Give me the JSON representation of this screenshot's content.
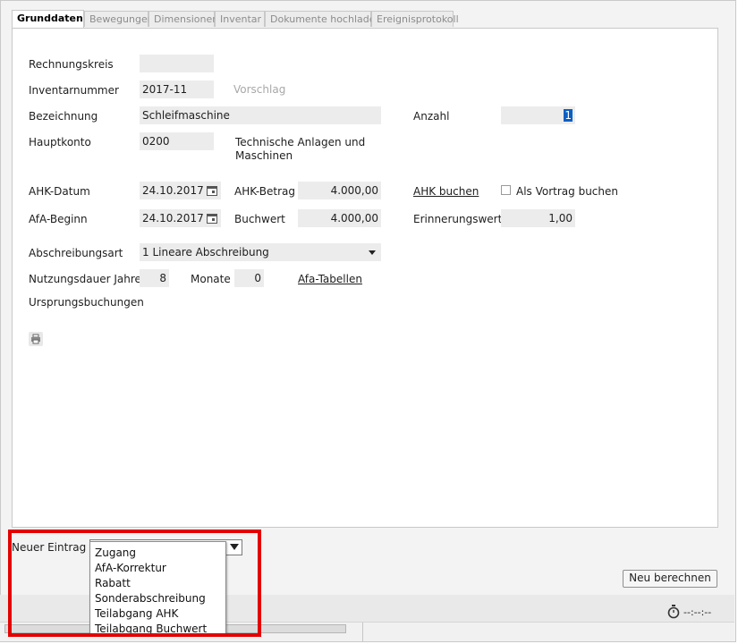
{
  "tabs": [
    {
      "label": "Grunddaten",
      "active": true
    },
    {
      "label": "Bewegungen",
      "active": false
    },
    {
      "label": "Dimensionen",
      "active": false
    },
    {
      "label": "Inventar",
      "active": false
    },
    {
      "label": "Dokumente hochladen",
      "active": false
    },
    {
      "label": "Ereignisprotokoll",
      "active": false
    }
  ],
  "form": {
    "rechnungskreis_label": "Rechnungskreis",
    "rechnungskreis_value": "",
    "inventarnummer_label": "Inventarnummer",
    "inventarnummer_value": "2017-11",
    "vorschlag_label": "Vorschlag",
    "bezeichnung_label": "Bezeichnung",
    "bezeichnung_value": "Schleifmaschine",
    "anzahl_label": "Anzahl",
    "anzahl_value": "1",
    "hauptkonto_label": "Hauptkonto",
    "hauptkonto_value": "0200",
    "hauptkonto_desc_line1": "Technische Anlagen und",
    "hauptkonto_desc_line2": "Maschinen",
    "ahk_datum_label": "AHK-Datum",
    "ahk_datum_value": "24.10.2017",
    "ahk_betrag_label": "AHK-Betrag",
    "ahk_betrag_value": "4.000,00",
    "ahk_buchen_link": "AHK buchen",
    "als_vortrag_label": "Als Vortrag buchen",
    "als_vortrag_checked": false,
    "afa_beginn_label": "AfA-Beginn",
    "afa_beginn_value": "24.10.2017",
    "buchwert_label": "Buchwert",
    "buchwert_value": "4.000,00",
    "erinnerungswert_label": "Erinnerungswert",
    "erinnerungswert_value": "1,00",
    "abschreibungsart_label": "Abschreibungsart",
    "abschreibungsart_value": "1 Lineare Abschreibung",
    "nutzungsdauer_label": "Nutzungsdauer Jahre",
    "nutzungsdauer_value": "8",
    "monate_label": "Monate",
    "monate_value": "0",
    "afa_tabellen_link": "Afa-Tabellen",
    "ursprungsbuchungen_label": "Ursprungsbuchungen"
  },
  "neuer_eintrag": {
    "label": "Neuer Eintrag",
    "options": [
      "Zugang",
      "AfA-Korrektur",
      "Rabatt",
      "Sonderabschreibung",
      "Teilabgang AHK",
      "Teilabgang Buchwert"
    ]
  },
  "buttons": {
    "neu_berechnen": "Neu berechnen"
  },
  "status": {
    "timer_text": "--:--:--"
  },
  "colors": {
    "highlight": "#e40000",
    "field_bg": "#ececec",
    "selection": "#0a5fc4"
  },
  "icons": {
    "calendar": "calendar-icon",
    "print": "print-icon",
    "dropdown": "chevron-down-icon",
    "timer": "stopwatch-icon"
  }
}
